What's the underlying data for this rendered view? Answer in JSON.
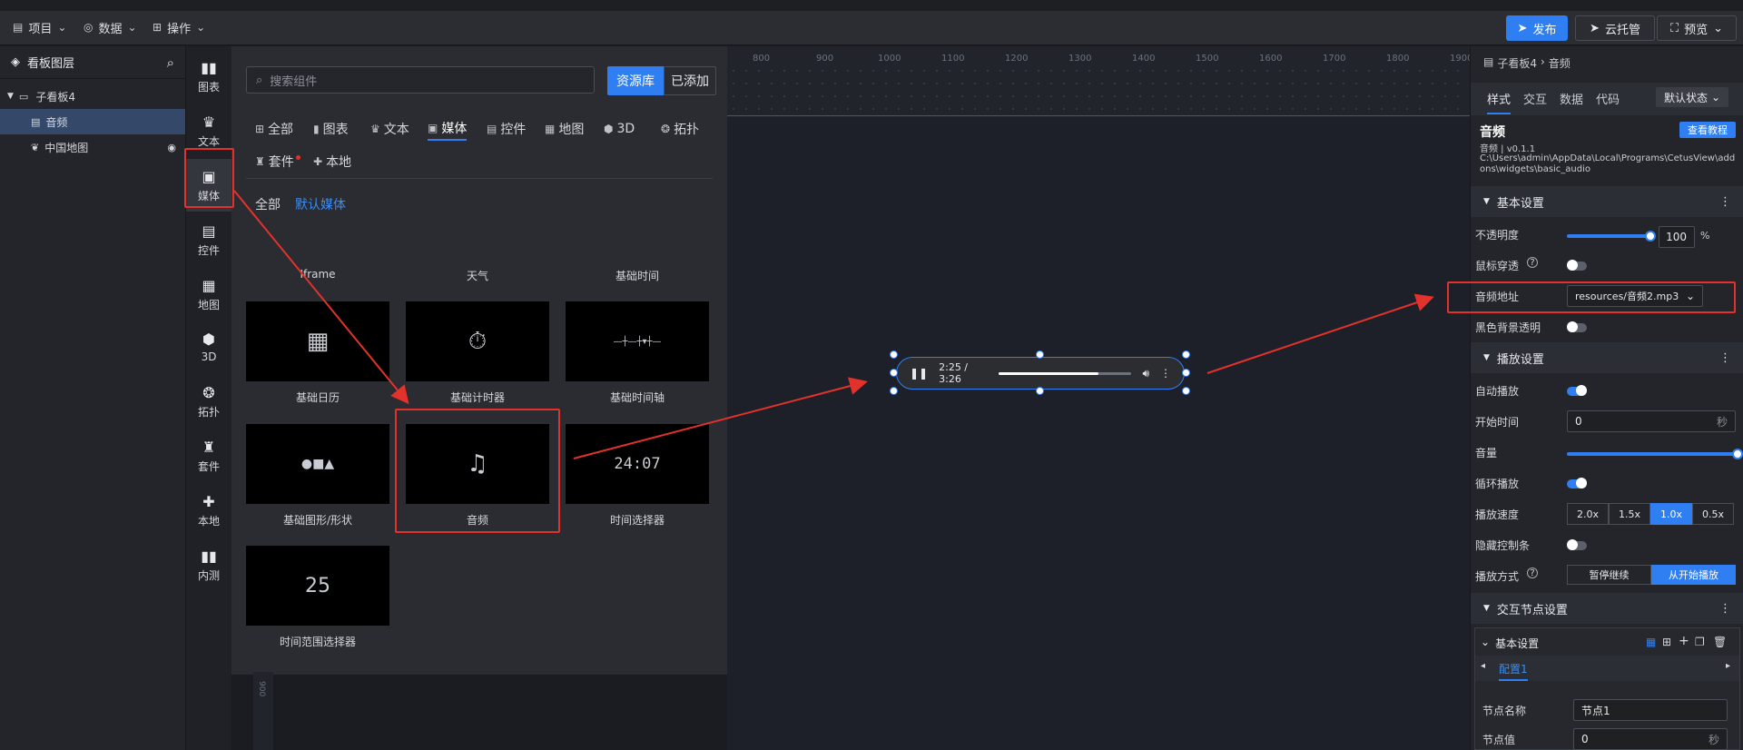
{
  "topbar": {
    "menus": [
      {
        "icon": "file-icon",
        "label": "项目"
      },
      {
        "icon": "database-icon",
        "label": "数据"
      },
      {
        "icon": "grid-icon",
        "label": "操作"
      }
    ],
    "publish_label": "发布",
    "cloud_label": "云托管",
    "preview_label": "预览"
  },
  "layers": {
    "title": "看板图层",
    "items": [
      {
        "label": "子看板4",
        "level": 0
      },
      {
        "label": "音频",
        "level": 1,
        "selected": true
      },
      {
        "label": "中国地图",
        "level": 1
      }
    ]
  },
  "categories": [
    "图表",
    "文本",
    "媒体",
    "控件",
    "地图",
    "3D",
    "拓扑",
    "套件",
    "本地",
    "内测"
  ],
  "library": {
    "search_placeholder": "搜索组件",
    "resource_label": "资源库",
    "added_label": "已添加",
    "tabs": [
      "全部",
      "图表",
      "文本",
      "媒体",
      "控件",
      "地图",
      "3D",
      "拓扑",
      "套件",
      "本地"
    ],
    "active_tab": "媒体",
    "sub_all": "全部",
    "sub_default": "默认媒体",
    "row0_labels": [
      "Iframe",
      "天气",
      "基础时间"
    ],
    "cards": [
      {
        "label": "基础日历",
        "icon": "calendar-icon"
      },
      {
        "label": "基础计时器",
        "icon": "timer-icon"
      },
      {
        "label": "基础时间轴",
        "icon": "timeline-icon"
      },
      {
        "label": "基础图形/形状",
        "icon": "shapes-icon"
      },
      {
        "label": "音频",
        "icon": "music-file-icon"
      },
      {
        "label": "时间选择器",
        "icon": "time-picker-icon"
      },
      {
        "label": "时间范围选择器",
        "icon": "date-range-icon"
      }
    ],
    "time_picker_text": "24:07",
    "range_text": "25"
  },
  "ruler": {
    "ticks": [
      "800",
      "900",
      "1000",
      "1100",
      "1200",
      "1300",
      "1400",
      "1500",
      "1600",
      "1700",
      "1800",
      "1900"
    ],
    "v_tick": "900"
  },
  "audio_player": {
    "time": "2:25 / 3:26",
    "progress": 0.75
  },
  "props": {
    "breadcrumb_parent": "子看板4",
    "breadcrumb_current": "音频",
    "tabs": [
      "样式",
      "交互",
      "数据",
      "代码"
    ],
    "state_label": "默认状态",
    "component_name": "音频",
    "component_version": "音频 | v0.1.1",
    "component_path": "C:\\Users\\admin\\AppData\\Local\\Programs\\CetusView\\addons\\widgets\\basic_audio",
    "tutorial_label": "查看教程",
    "basic_section": "基本设置",
    "opacity_label": "不透明度",
    "opacity_value": "100",
    "opacity_unit": "%",
    "mouse_through_label": "鼠标穿透",
    "audio_url_label": "音频地址",
    "audio_url_value": "resources/音频2.mp3",
    "black_bg_label": "黑色背景透明",
    "play_section": "播放设置",
    "autoplay_label": "自动播放",
    "start_time_label": "开始时间",
    "start_time_value": "0",
    "time_unit": "秒",
    "volume_label": "音量",
    "loop_label": "循环播放",
    "speed_label": "播放速度",
    "speeds": [
      "2.0x",
      "1.5x",
      "1.0x",
      "0.5x"
    ],
    "active_speed": "1.0x",
    "hide_controls_label": "隐藏控制条",
    "play_mode_label": "播放方式",
    "play_modes": [
      "暂停继续",
      "从开始播放"
    ],
    "interact_section": "交互节点设置",
    "sub_basic": "基本设置",
    "config_tab": "配置1",
    "node_name_label": "节点名称",
    "node_name_value": "节点1",
    "node_value_label": "节点值",
    "node_value_value": "0",
    "node_value_unit": "秒"
  },
  "colors": {
    "accent": "#2f7ff2",
    "highlight": "#e2322b"
  }
}
